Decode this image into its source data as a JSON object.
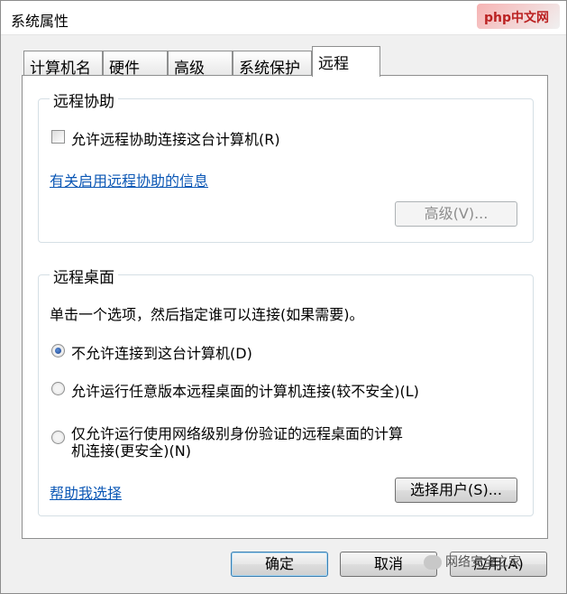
{
  "window": {
    "title": "系统属性"
  },
  "watermark": {
    "top": "php中文网",
    "bottom": "网络安全之家"
  },
  "tabs": [
    {
      "label": "计算机名"
    },
    {
      "label": "硬件"
    },
    {
      "label": "高级"
    },
    {
      "label": "系统保护"
    },
    {
      "label": "远程",
      "active": true
    }
  ],
  "remote_assistance": {
    "title": "远程协助",
    "allow_label": "允许远程协助连接这台计算机(R)",
    "allow_checked": false,
    "info_link": "有关启用远程协助的信息",
    "advanced_button": "高级(V)..."
  },
  "remote_desktop": {
    "title": "远程桌面",
    "description": "单击一个选项，然后指定谁可以连接(如果需要)。",
    "options": [
      {
        "label": "不允许连接到这台计算机(D)",
        "checked": true
      },
      {
        "label": "允许运行任意版本远程桌面的计算机连接(较不安全)(L)",
        "checked": false
      },
      {
        "label_line1": "仅允许运行使用网络级别身份验证的远程桌面的计算",
        "label_line2": "机连接(更安全)(N)",
        "checked": false
      }
    ],
    "help_link": "帮助我选择",
    "select_users_button": "选择用户(S)..."
  },
  "footer": {
    "ok": "确定",
    "cancel": "取消",
    "apply": "应用(A)"
  }
}
